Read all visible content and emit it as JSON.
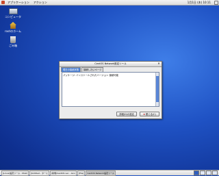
{
  "top_panel": {
    "menus": [
      "アプリケーション",
      "アクション"
    ],
    "clock": "1月1日 (木) 10:11"
  },
  "desktop": {
    "icons": [
      {
        "label": "コンピュータ",
        "icon": "computer-icon"
      },
      {
        "label": "rootのホーム",
        "icon": "home-folder-icon"
      },
      {
        "label": "ごみ箱",
        "icon": "trash-icon"
      }
    ]
  },
  "dialog": {
    "title": "CentOS Network設定ツール",
    "tabs": [
      "現在の接続状態",
      "接続したいページ"
    ],
    "content_text": "パッケージ: インストールされたバージョン 接続可能",
    "details_button": "詳細(D)の設定",
    "close_button": "閉じる(C)"
  },
  "taskbar": {
    "tasks": [
      "[Linux/設定ツール - Mozil",
      "[Untitled - ターミ",
      "[新規/CentOS ver. - Gno",
      "[File]",
      "CentOS Network設定ツール"
    ],
    "workspaces": 4,
    "active_workspace": 1
  }
}
